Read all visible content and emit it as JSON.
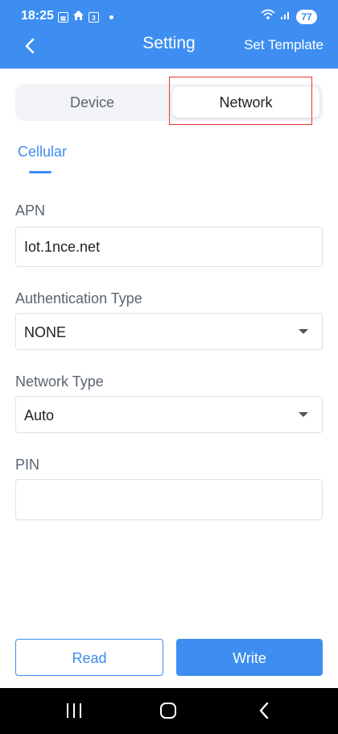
{
  "status_bar": {
    "time": "18:25",
    "battery": "77",
    "icons": [
      "sim-icon",
      "home-icon",
      "notification-icon",
      "dot-icon",
      "wifi-icon",
      "signal-icon",
      "battery-icon"
    ]
  },
  "header": {
    "title": "Setting",
    "action": "Set Template",
    "back_icon": "chevron-left-icon"
  },
  "tabs": {
    "items": [
      {
        "label": "Device",
        "selected": false
      },
      {
        "label": "Network",
        "selected": true
      }
    ],
    "highlight_color": "#e53935"
  },
  "subtab": {
    "label": "Cellular"
  },
  "form": {
    "apn": {
      "label": "APN",
      "value": "Iot.1nce.net"
    },
    "auth": {
      "label": "Authentication Type",
      "value": "NONE"
    },
    "network_type": {
      "label": "Network Type",
      "value": "Auto"
    },
    "pin": {
      "label": "PIN",
      "value": ""
    }
  },
  "buttons": {
    "read": "Read",
    "write": "Write"
  },
  "colors": {
    "accent": "#3d8ef0",
    "background": "#ffffff",
    "system_nav": "#000000"
  }
}
